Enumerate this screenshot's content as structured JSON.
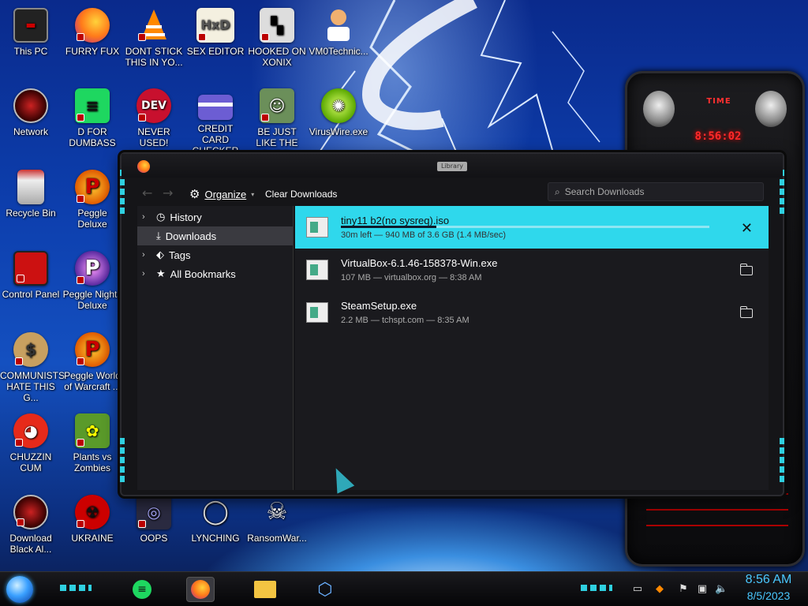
{
  "desktop": {
    "icons": [
      {
        "label": "This PC",
        "icon": "monitor-icon"
      },
      {
        "label": "FURRY FUX",
        "icon": "firefox-icon"
      },
      {
        "label": "DONT STICK THIS IN YO...",
        "icon": "vlc-cone-icon"
      },
      {
        "label": "SEX EDITOR",
        "icon": "hxd-editor-icon"
      },
      {
        "label": "HOOKED ON XONIX",
        "icon": "xonix-game-icon"
      },
      {
        "label": "VM0Technic...",
        "icon": "doctor-icon"
      },
      {
        "label": "Network",
        "icon": "alien-network-icon"
      },
      {
        "label": "D FOR DUMBASS",
        "icon": "spotify-like-icon"
      },
      {
        "label": "NEVER USED!",
        "icon": "devcpp-icon"
      },
      {
        "label": "CREDIT CARD CHECKER",
        "icon": "credit-card-icon"
      },
      {
        "label": "BE JUST LIKE THE DUDE!",
        "icon": "elf-icon"
      },
      {
        "label": "VirusWire.exe",
        "icon": "limewire-icon"
      },
      {
        "label": "Recycle Bin",
        "icon": "recycle-bin-icon"
      },
      {
        "label": "Peggle Deluxe",
        "icon": "peggle-icon"
      },
      {
        "label": "Control Panel",
        "icon": "control-panel-icon"
      },
      {
        "label": "Peggle Nights Deluxe",
        "icon": "peggle-nights-icon"
      },
      {
        "label": "COMMUNISTS HATE THIS G...",
        "icon": "money-bag-icon"
      },
      {
        "label": "Peggle World of Warcraft ...",
        "icon": "peggle-wow-icon"
      },
      {
        "label": "CHUZZIN CUM",
        "icon": "chuzzle-icon"
      },
      {
        "label": "Plants vs Zombies",
        "icon": "plants-zombies-icon"
      },
      {
        "label": "Download Black Al...",
        "icon": "alien-download-icon"
      },
      {
        "label": "UKRAINE",
        "icon": "radiation-icon"
      },
      {
        "label": "OOPS",
        "icon": "oops-icon"
      },
      {
        "label": "LYNCHING",
        "icon": "noose-icon"
      },
      {
        "label": "RansomWar...",
        "icon": "skull-icon"
      }
    ]
  },
  "gadget": {
    "label": "TIME",
    "clock": "8:56:02"
  },
  "library": {
    "title": "Library",
    "toolbar": {
      "organize": "Organize",
      "clear": "Clear Downloads",
      "search_placeholder": "Search Downloads"
    },
    "sidebar": [
      {
        "label": "History",
        "icon": "clock-icon",
        "expandable": true
      },
      {
        "label": "Downloads",
        "icon": "download-icon",
        "expandable": false
      },
      {
        "label": "Tags",
        "icon": "tag-icon",
        "expandable": true
      },
      {
        "label": "All Bookmarks",
        "icon": "star-icon",
        "expandable": true
      }
    ],
    "downloads": [
      {
        "name": "tiny11 b2(no sysreq).iso",
        "meta": "30m left — 940 MB of 3.6 GB (1.4 MB/sec)",
        "progress": 0.26,
        "state": "active"
      },
      {
        "name": "VirtualBox-6.1.46-158378-Win.exe",
        "meta": "107 MB — virtualbox.org — 8:38 AM",
        "state": "done"
      },
      {
        "name": "SteamSetup.exe",
        "meta": "2.2 MB — tchspt.com — 8:35 AM",
        "state": "done"
      }
    ]
  },
  "taskbar": {
    "time": "8:56 AM",
    "date": "8/5/2023"
  },
  "colors": {
    "accent": "#2fd8ec",
    "clock": "#4ac8ff",
    "gadget_red": "#ff2a2a"
  }
}
